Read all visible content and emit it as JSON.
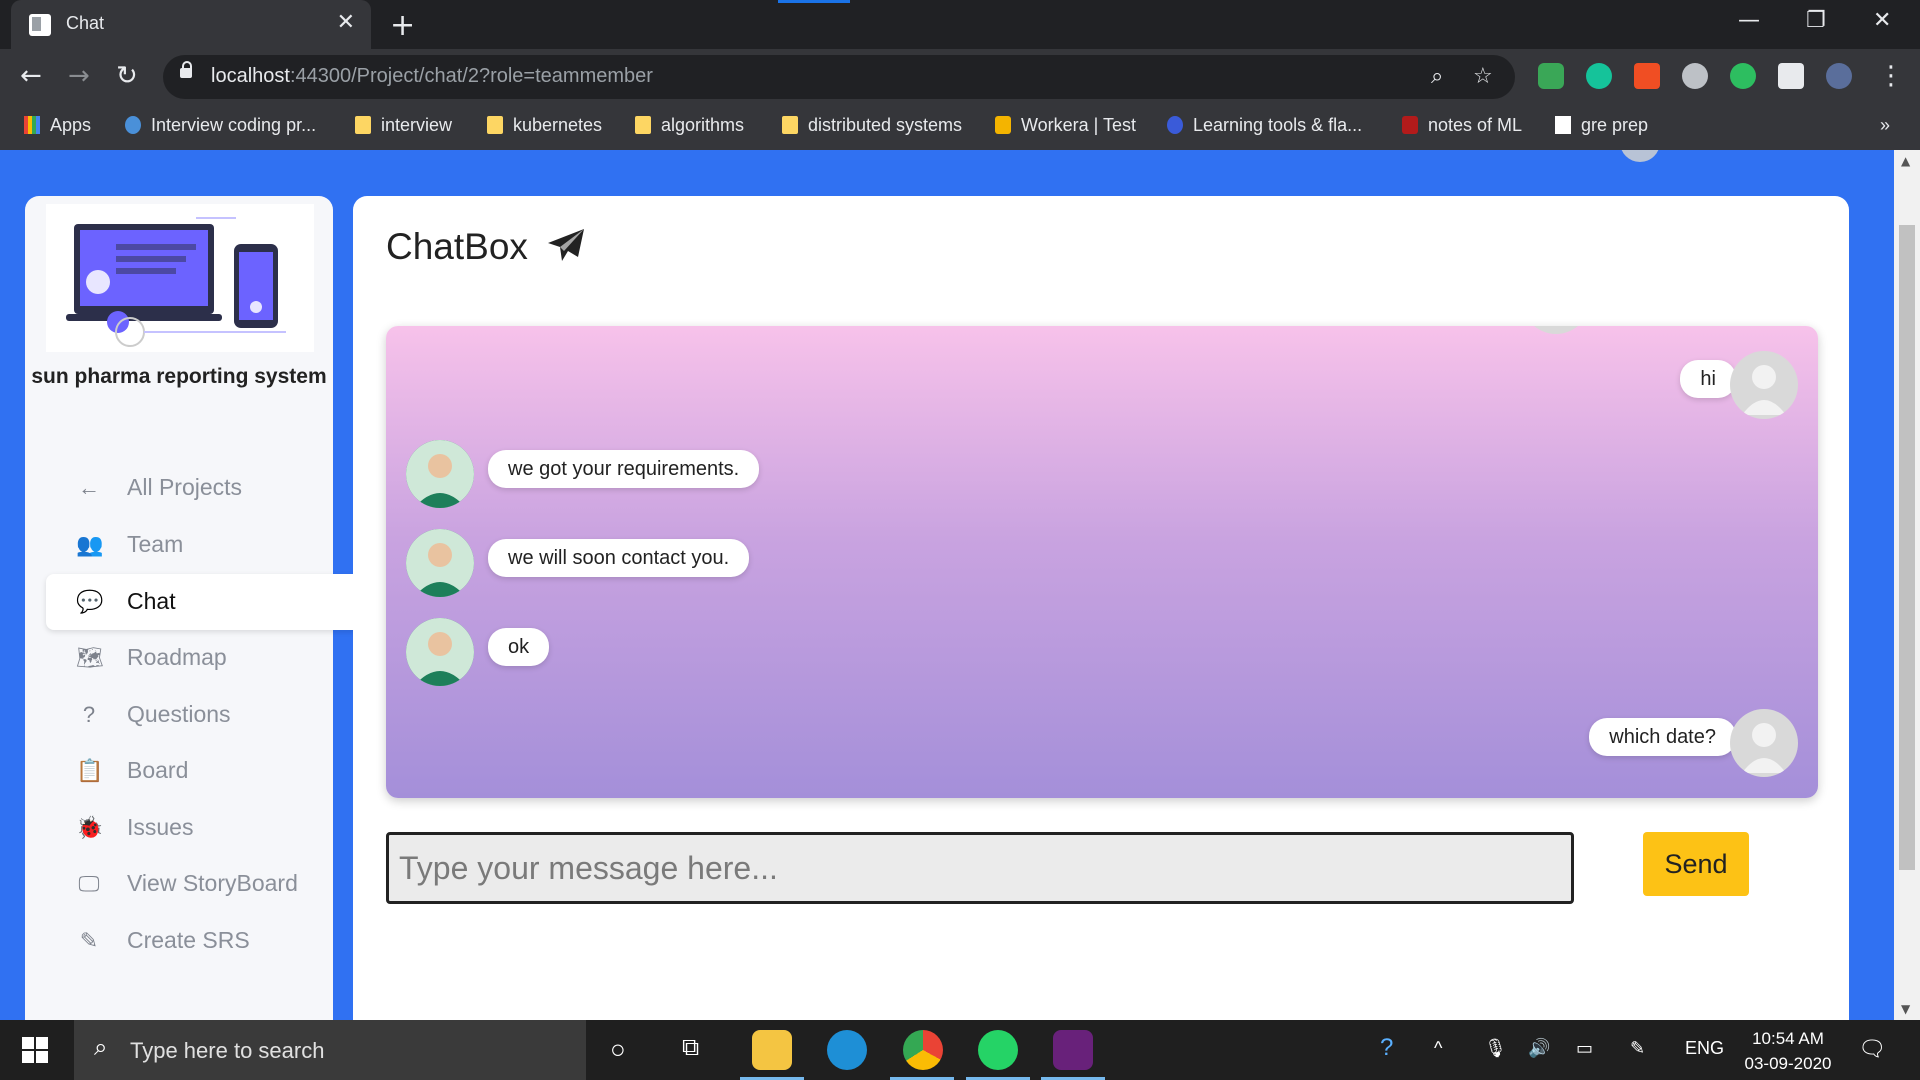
{
  "browser": {
    "tab_title": "Chat",
    "close_tab": "✕",
    "new_tab": "+",
    "url_host": "localhost",
    "url_rest": ":44300/Project/chat/2?role=teammember",
    "win_min": "—",
    "win_max": "❐",
    "win_close": "✕",
    "bookmarks": [
      {
        "label": "Apps"
      },
      {
        "label": "Interview coding pr..."
      },
      {
        "label": "interview"
      },
      {
        "label": "kubernetes"
      },
      {
        "label": "algorithms"
      },
      {
        "label": "distributed systems"
      },
      {
        "label": "Workera | Test"
      },
      {
        "label": "Learning tools & fla..."
      },
      {
        "label": "notes of ML"
      },
      {
        "label": "gre prep"
      }
    ],
    "more": "»"
  },
  "sidebar": {
    "company": "sun pharma reporting system",
    "items": [
      {
        "label": "All Projects",
        "icon": "←"
      },
      {
        "label": "Team",
        "icon": "👥"
      },
      {
        "label": "Chat",
        "icon": "💬"
      },
      {
        "label": "Roadmap",
        "icon": "🗺"
      },
      {
        "label": "Questions",
        "icon": "?"
      },
      {
        "label": "Board",
        "icon": "📋"
      },
      {
        "label": "Issues",
        "icon": "🐞"
      },
      {
        "label": "View StoryBoard",
        "icon": "🖵"
      },
      {
        "label": "Create SRS",
        "icon": "✎"
      }
    ],
    "active": "Chat"
  },
  "chat": {
    "title": "ChatBox",
    "messages": [
      {
        "text": "hi",
        "side": "right"
      },
      {
        "text": "we got your requirements.",
        "side": "left"
      },
      {
        "text": "we will soon contact you.",
        "side": "left"
      },
      {
        "text": "ok",
        "side": "left"
      },
      {
        "text": "which date?",
        "side": "right"
      }
    ],
    "input_placeholder": "Type your message here...",
    "send_label": "Send"
  },
  "taskbar": {
    "search_placeholder": "Type here to search",
    "language": "ENG",
    "time": "10:54 AM",
    "date": "03-09-2020"
  },
  "colors": {
    "page_bg": "#3071f2",
    "send_button": "#fdc215",
    "chat_gradient_top": "#f7c2ea",
    "chat_gradient_bottom": "#a48fd9"
  }
}
